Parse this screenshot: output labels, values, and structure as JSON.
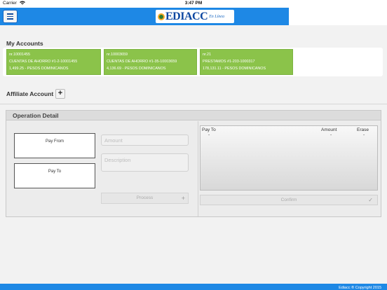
{
  "status_bar": {
    "carrier": "Carrier",
    "wifi_icon": "wifi-icon",
    "time": "3:47 PM"
  },
  "header": {
    "menu_icon": "hamburger-menu-icon",
    "logo_text": "EDIACC",
    "logo_sub": "En Línea"
  },
  "accounts": {
    "title": "My Accounts",
    "items": [
      {
        "number": "nr.10001455",
        "name": "CUENTAS DE AHORRO #1-2-10001455",
        "balance": "1,499.25 - PESOS DOMINICANOS"
      },
      {
        "number": "nr.10003659",
        "name": "CUENTAS DE AHORRO #1-35-10003659",
        "balance": "4,136.69 - PESOS DOMINICANOS"
      },
      {
        "number": "nr.21",
        "name": "PRESTAMOS #1-203-1000317",
        "balance": "178,131.11 - PESOS DOMINICANOS"
      }
    ],
    "color": "#8bc34a"
  },
  "affiliate": {
    "label": "Affiliate Account",
    "add": "+"
  },
  "operation": {
    "title": "Operation Detail",
    "pay_from": "Pay From",
    "pay_to": "Pay To",
    "amount_placeholder": "Amount",
    "description_placeholder": "Description",
    "process_label": "Process",
    "process_icon": "+",
    "list_headers": {
      "pay_to": "Pay To",
      "amount": "Amount",
      "erase": "Erase"
    },
    "list_row": {
      "pay_to": "-",
      "amount": "-",
      "erase": "-"
    },
    "confirm_label": "Confirm",
    "confirm_icon": "✓"
  },
  "footer": {
    "text": "Ediacc ® Copyright 2015"
  },
  "colors": {
    "brand_blue": "#1e88e5",
    "account_green": "#8bc34a"
  }
}
